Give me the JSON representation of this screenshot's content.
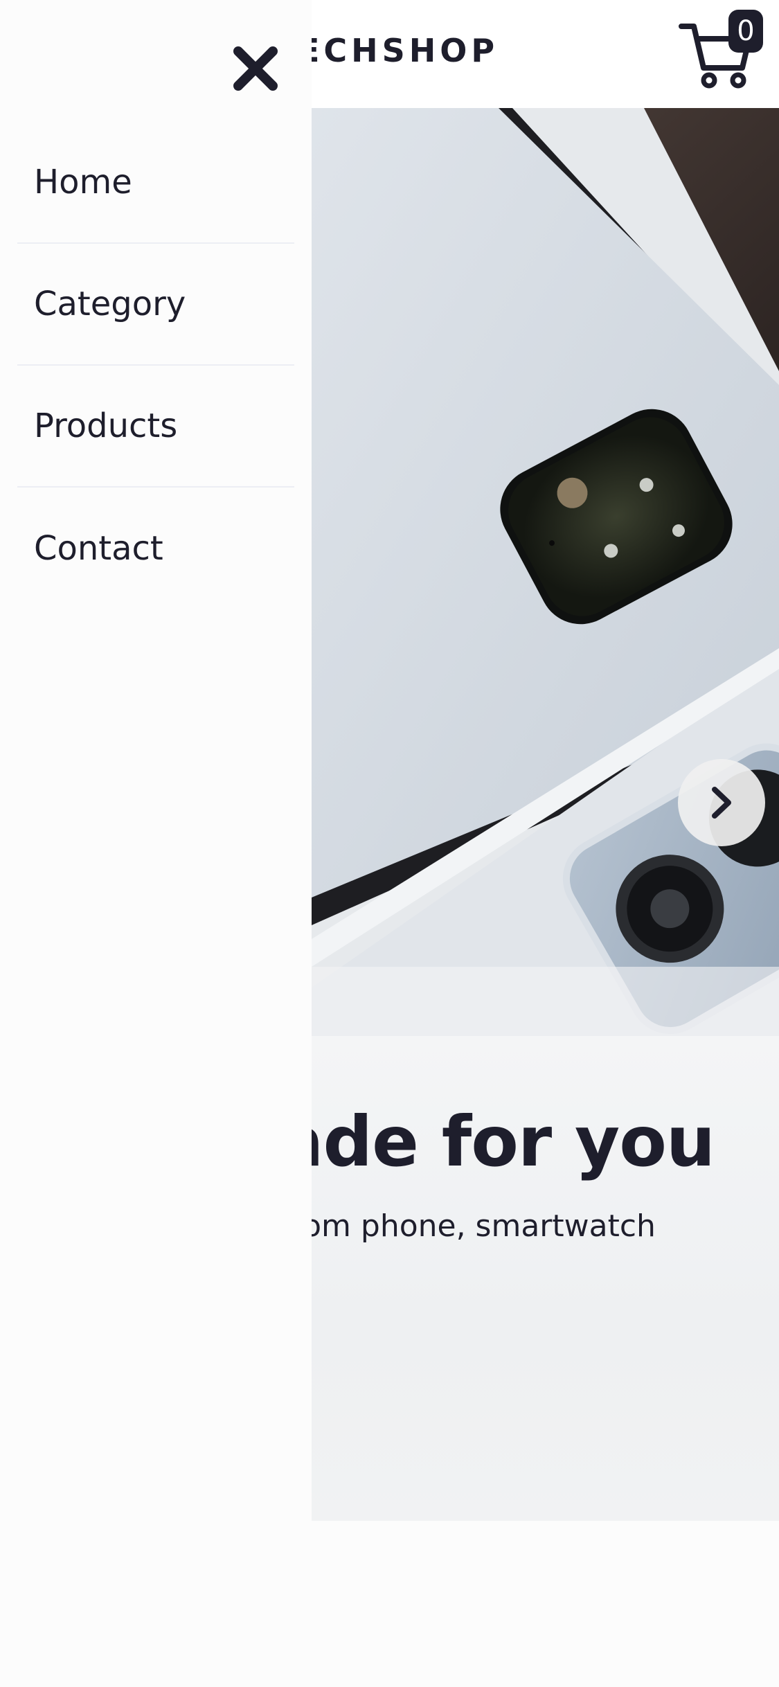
{
  "header": {
    "brand": "ECHSHOP",
    "cart_count": "0"
  },
  "drawer": {
    "menu": [
      {
        "label": "Home"
      },
      {
        "label": "Category"
      },
      {
        "label": "Products"
      },
      {
        "label": "Contact"
      }
    ]
  },
  "hero": {
    "headline": "ade for you",
    "subline": "rom phone, smartwatch"
  },
  "icons": {
    "close": "close-icon",
    "cart": "cart-icon",
    "next": "chevron-right-icon"
  },
  "colors": {
    "text": "#1e1e2c",
    "background": "#fcfcfc",
    "divider": "#eceef4"
  }
}
